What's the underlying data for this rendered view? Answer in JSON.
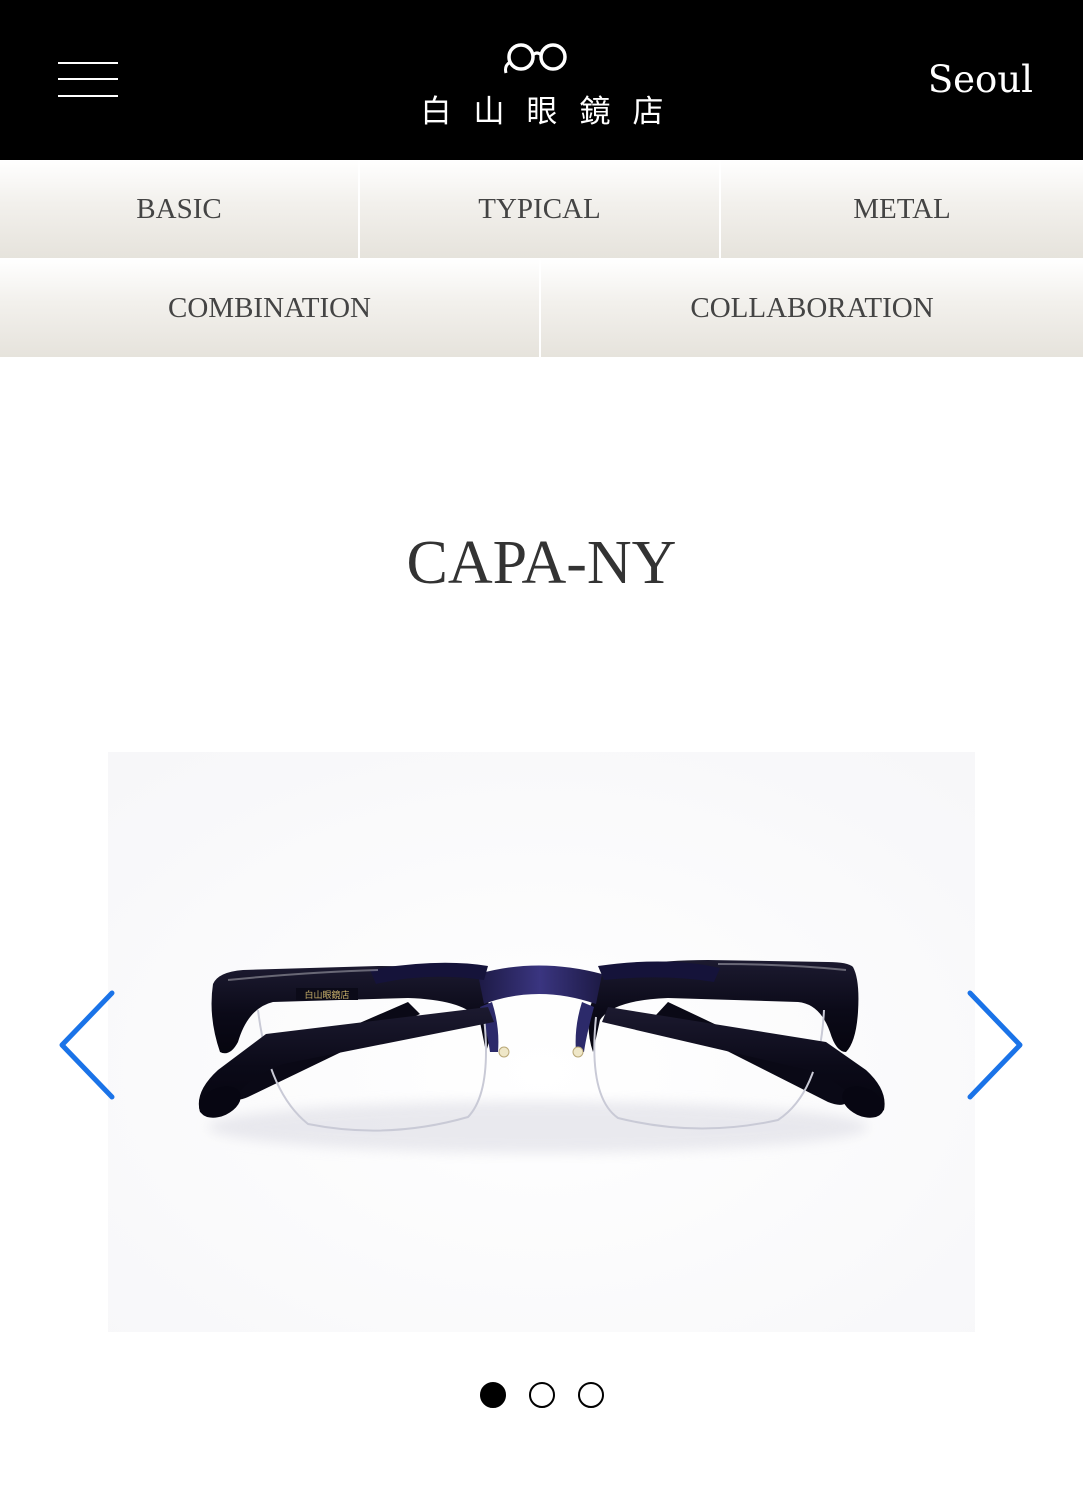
{
  "header": {
    "logo_text": "白山眼鏡店",
    "city": "Seoul"
  },
  "categories": {
    "row1": [
      "BASIC",
      "TYPICAL",
      "METAL"
    ],
    "row2": [
      "COMBINATION",
      "COLLABORATION"
    ]
  },
  "product": {
    "name": "CAPA-NY",
    "image_alt": "Black half-rim eyeglasses",
    "temple_imprint": "白山眼鏡店"
  },
  "carousel": {
    "slide_count": 3,
    "active_index": 0,
    "arrow_color": "#1a73e8"
  },
  "colors": {
    "header_bg": "#000000",
    "nav_text": "#444444",
    "title_text": "#333333"
  }
}
